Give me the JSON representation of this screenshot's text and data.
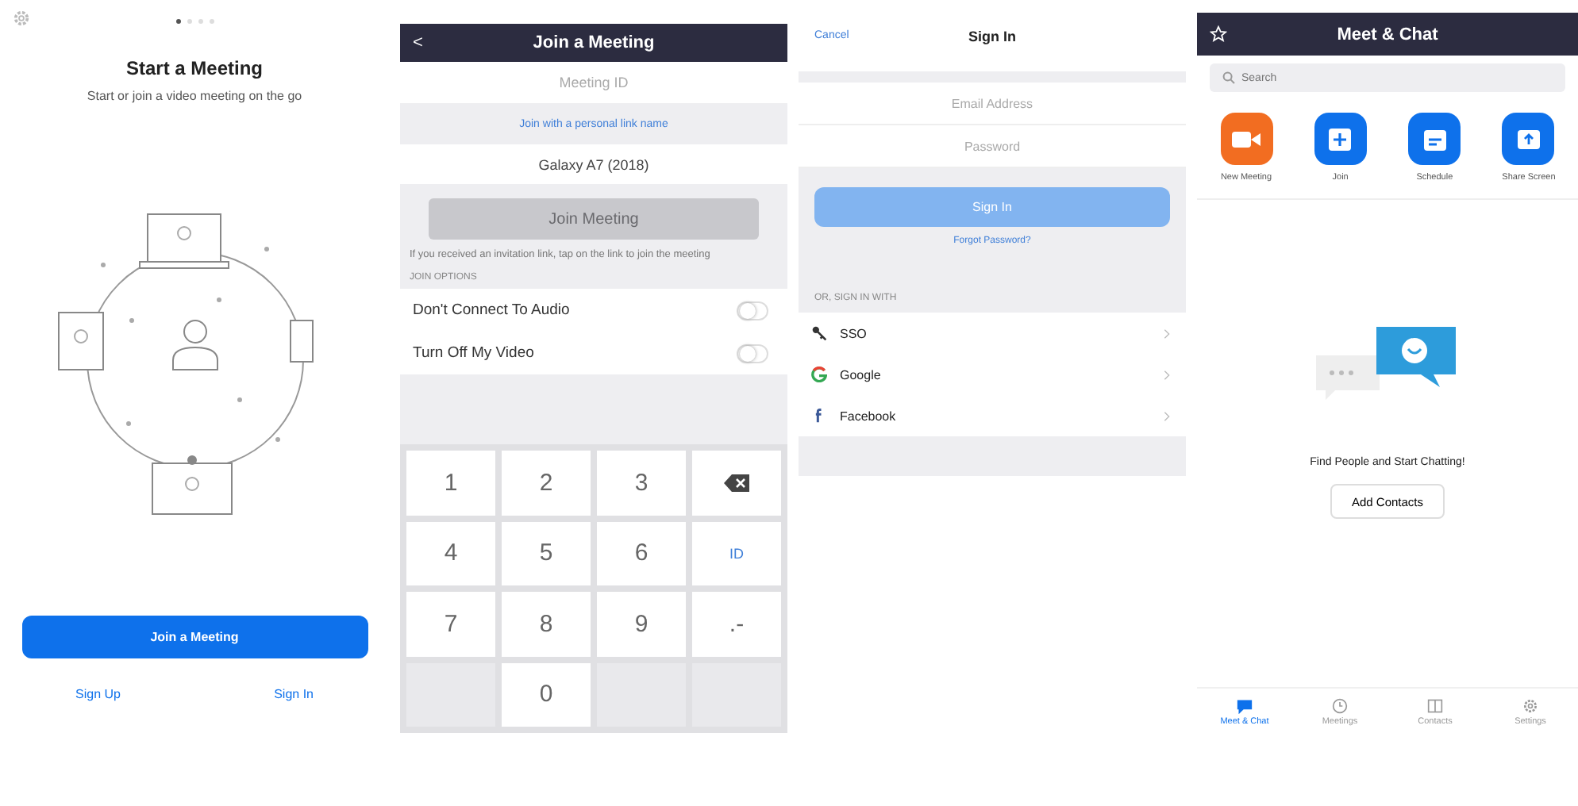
{
  "welcome": {
    "page_dots": [
      {
        "selected": true
      },
      {
        "selected": false
      },
      {
        "selected": false
      },
      {
        "selected": false
      }
    ],
    "title": "Start a Meeting",
    "subtitle": "Start or join a video meeting on the go",
    "join_button": "Join a Meeting",
    "sign_up": "Sign Up",
    "sign_in": "Sign In"
  },
  "join_meeting": {
    "back": "<",
    "title": "Join a Meeting",
    "meeting_id": {
      "placeholder": "Meeting ID"
    },
    "personal_link": "Join with a personal link name",
    "device_name": "Galaxy A7 (2018)",
    "join_button": {
      "label": "Join Meeting",
      "disabled": true
    },
    "hint": "If you received an invitation link, tap on the link to join the meeting",
    "options_label": "JOIN OPTIONS",
    "options": [
      {
        "label": "Don't Connect To Audio",
        "on": false
      },
      {
        "label": "Turn Off My Video",
        "on": false
      }
    ],
    "keypad": [
      {
        "kind": "digit",
        "label": "1"
      },
      {
        "kind": "digit",
        "label": "2"
      },
      {
        "kind": "digit",
        "label": "3"
      },
      {
        "kind": "backspace"
      },
      {
        "kind": "digit",
        "label": "4"
      },
      {
        "kind": "digit",
        "label": "5"
      },
      {
        "kind": "digit",
        "label": "6"
      },
      {
        "kind": "symbol",
        "label": "ID"
      },
      {
        "kind": "digit",
        "label": "7"
      },
      {
        "kind": "digit",
        "label": "8"
      },
      {
        "kind": "digit",
        "label": "9"
      },
      {
        "kind": "digit",
        "label": ".-"
      },
      {
        "kind": "blank"
      },
      {
        "kind": "digit",
        "label": "0"
      },
      {
        "kind": "blank"
      },
      {
        "kind": "blank"
      }
    ]
  },
  "sign_in": {
    "cancel": "Cancel",
    "title": "Sign In",
    "email": {
      "placeholder": "Email Address"
    },
    "password": {
      "placeholder": "Password"
    },
    "sign_in_button": {
      "label": "Sign In",
      "disabled": true
    },
    "forgot": "Forgot Password?",
    "or_label": "OR, SIGN IN WITH",
    "providers": [
      {
        "kind": "sso",
        "label": "SSO"
      },
      {
        "kind": "google",
        "label": "Google"
      },
      {
        "kind": "facebook",
        "label": "Facebook"
      }
    ]
  },
  "meet_chat": {
    "title": "Meet & Chat",
    "search": {
      "placeholder": "Search"
    },
    "actions": [
      {
        "kind": "video",
        "label": "New Meeting",
        "color": "#f26d21"
      },
      {
        "kind": "plus",
        "label": "Join",
        "color": "#0e71eb"
      },
      {
        "kind": "calendar",
        "label": "Schedule",
        "color": "#0e71eb"
      },
      {
        "kind": "share",
        "label": "Share Screen",
        "color": "#0e71eb"
      }
    ],
    "empty_message": "Find People and Start Chatting!",
    "add_contacts": "Add Contacts",
    "tabs": [
      {
        "kind": "chat",
        "label": "Meet & Chat",
        "selected": true
      },
      {
        "kind": "clock",
        "label": "Meetings",
        "selected": false
      },
      {
        "kind": "contacts",
        "label": "Contacts",
        "selected": false
      },
      {
        "kind": "gear",
        "label": "Settings",
        "selected": false
      }
    ]
  }
}
